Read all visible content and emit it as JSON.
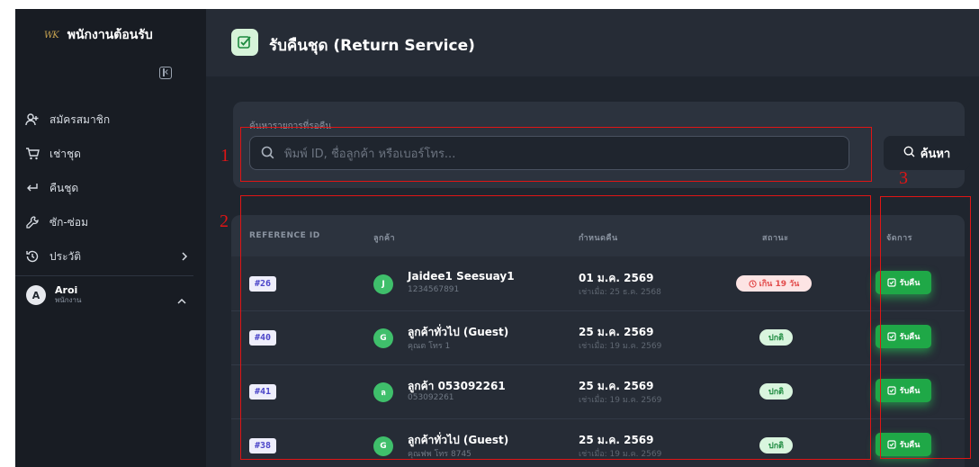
{
  "sidebar": {
    "brand_logo": "WK",
    "brand_title": "พนักงานต้อนรับ",
    "items": [
      {
        "label": "สมัครสมาชิก",
        "icon": "user-plus-icon"
      },
      {
        "label": "เช่าชุด",
        "icon": "cart-icon"
      },
      {
        "label": "คืนชุด",
        "icon": "return-arrow-icon"
      },
      {
        "label": "ซัก-ซ่อม",
        "icon": "wrench-icon"
      },
      {
        "label": "ประวัติ",
        "icon": "history-icon"
      }
    ],
    "user": {
      "initial": "A",
      "name": "Aroi",
      "role": "พนักงาน"
    }
  },
  "header": {
    "title": "รับคืนชุด (Return Service)"
  },
  "search": {
    "label": "ค้นหารายการที่รอคืน",
    "placeholder": "พิมพ์ ID, ชื่อลูกค้า หรือเบอร์โทร...",
    "button_label": "ค้นหา"
  },
  "table": {
    "headers": {
      "ref": "REFERENCE ID",
      "customer": "ลูกค้า",
      "due": "กำหนดคืน",
      "status": "สถานะ",
      "action": "จัดการ"
    },
    "rows": [
      {
        "ref": "#26",
        "avatar": "J",
        "name": "Jaidee1 Seesuay1",
        "sub": "1234567891",
        "due": "01 ม.ค. 2569",
        "rented": "เช่าเมื่อ: 25 ธ.ค. 2568",
        "status": "เกิน 19 วัน",
        "status_type": "overdue",
        "action": "รับคืน"
      },
      {
        "ref": "#40",
        "avatar": "G",
        "name": "ลูกค้าทั่วไป (Guest)",
        "sub": "คุณต โทร 1",
        "due": "25 ม.ค. 2569",
        "rented": "เช่าเมื่อ: 19 ม.ค. 2569",
        "status": "ปกติ",
        "status_type": "normal",
        "action": "รับคืน"
      },
      {
        "ref": "#41",
        "avatar": "ล",
        "name": "ลูกค้า 053092261",
        "sub": "053092261",
        "due": "25 ม.ค. 2569",
        "rented": "เช่าเมื่อ: 19 ม.ค. 2569",
        "status": "ปกติ",
        "status_type": "normal",
        "action": "รับคืน"
      },
      {
        "ref": "#38",
        "avatar": "G",
        "name": "ลูกค้าทั่วไป (Guest)",
        "sub": "คุณฟพ โทร 8745",
        "due": "25 ม.ค. 2569",
        "rented": "เช่าเมื่อ: 19 ม.ค. 2569",
        "status": "ปกติ",
        "status_type": "normal",
        "action": "รับคืน"
      }
    ]
  },
  "annotations": [
    "1",
    "2",
    "3"
  ],
  "colors": {
    "accent_green": "#1fa847",
    "annotation_red": "#e01515",
    "overdue_red": "#e24a4a"
  }
}
